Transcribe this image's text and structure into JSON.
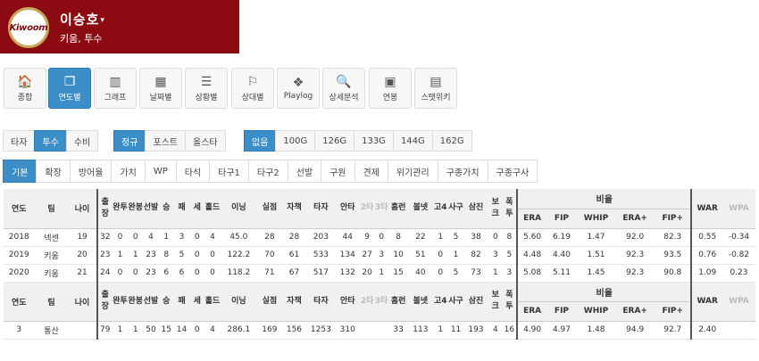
{
  "header": {
    "logo_text": "Kiwoom",
    "player_name": "이승호",
    "team_pos": "키움, 투수",
    "accent": "#8c0a12"
  },
  "toolbar": [
    {
      "label": "종합",
      "icon": "home-icon",
      "glyph": "🏠"
    },
    {
      "label": "연도별",
      "icon": "copy-icon",
      "glyph": "❐"
    },
    {
      "label": "그래프",
      "icon": "bar-chart-icon",
      "glyph": "▥"
    },
    {
      "label": "날짜별",
      "icon": "calendar-icon",
      "glyph": "▦"
    },
    {
      "label": "상황별",
      "icon": "list-icon",
      "glyph": "☰"
    },
    {
      "label": "상대별",
      "icon": "flag-icon",
      "glyph": "⚐"
    },
    {
      "label": "Playlog",
      "icon": "cubes-icon",
      "glyph": "❖"
    },
    {
      "label": "상세분석",
      "icon": "search-icon",
      "glyph": "🔍"
    },
    {
      "label": "연봉",
      "icon": "money-icon",
      "glyph": "▣"
    },
    {
      "label": "스탯위키",
      "icon": "newspaper-icon",
      "glyph": "▤"
    }
  ],
  "filters": {
    "role": [
      "타자",
      "투수",
      "수비"
    ],
    "season": [
      "정규",
      "포스트",
      "올스타"
    ],
    "level": [
      "없음",
      "100G",
      "126G",
      "133G",
      "144G",
      "162G"
    ]
  },
  "tabs": [
    "기본",
    "확장",
    "방어율",
    "가치",
    "WP",
    "타석",
    "타구1",
    "타구2",
    "선발",
    "구원",
    "견제",
    "위기관리",
    "구종가치",
    "구종구사"
  ],
  "table": {
    "ratio_label": "비율",
    "cols": [
      "연도",
      "팀",
      "나이",
      "출장",
      "완투",
      "완봉",
      "선발",
      "승",
      "패",
      "세",
      "홀드",
      "이닝",
      "실점",
      "자책",
      "타자",
      "안타",
      "2타",
      "3타",
      "홈런",
      "볼넷",
      "고4",
      "사구",
      "삼진",
      "보크",
      "폭투",
      "ERA",
      "FIP",
      "WHIP",
      "ERA+",
      "FIP+",
      "WAR",
      "WPA"
    ],
    "rows": [
      [
        "2018",
        "넥센",
        "19",
        "32",
        "0",
        "0",
        "4",
        "1",
        "3",
        "0",
        "4",
        "45.0",
        "28",
        "28",
        "203",
        "44",
        "9",
        "0",
        "8",
        "22",
        "1",
        "5",
        "38",
        "0",
        "8",
        "5.60",
        "6.19",
        "1.47",
        "92.0",
        "82.3",
        "0.55",
        "-0.34"
      ],
      [
        "2019",
        "키움",
        "20",
        "23",
        "1",
        "1",
        "23",
        "8",
        "5",
        "0",
        "0",
        "122.2",
        "70",
        "61",
        "533",
        "134",
        "27",
        "3",
        "10",
        "51",
        "0",
        "1",
        "82",
        "3",
        "5",
        "4.48",
        "4.40",
        "1.51",
        "92.3",
        "93.5",
        "0.76",
        "-0.82"
      ],
      [
        "2020",
        "키움",
        "21",
        "24",
        "0",
        "0",
        "23",
        "6",
        "6",
        "0",
        "0",
        "118.2",
        "71",
        "67",
        "517",
        "132",
        "20",
        "1",
        "15",
        "40",
        "0",
        "5",
        "73",
        "1",
        "3",
        "5.08",
        "5.11",
        "1.45",
        "92.3",
        "90.8",
        "1.09",
        "0.23"
      ]
    ],
    "total": [
      "3",
      "통산",
      "",
      "79",
      "1",
      "1",
      "50",
      "15",
      "14",
      "0",
      "4",
      "286.1",
      "169",
      "156",
      "1253",
      "310",
      "",
      "",
      "33",
      "113",
      "1",
      "11",
      "193",
      "4",
      "16",
      "4.90",
      "4.97",
      "1.48",
      "94.9",
      "92.7",
      "2.40",
      ""
    ]
  }
}
